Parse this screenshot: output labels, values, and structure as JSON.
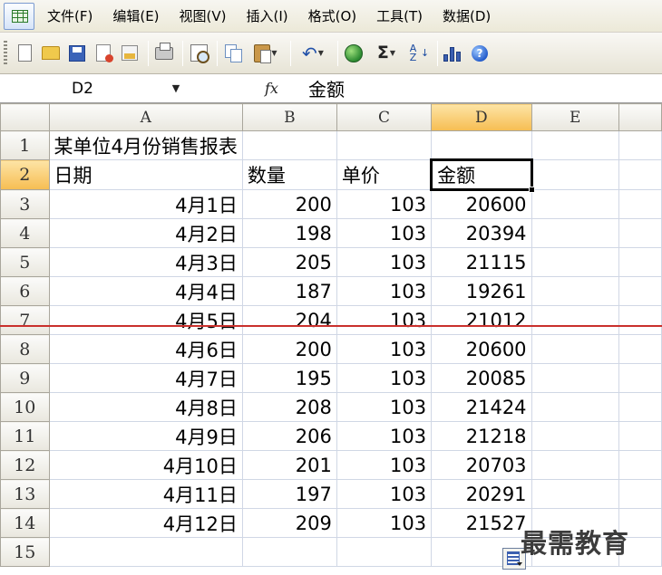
{
  "menu": {
    "items": [
      "文件(F)",
      "编辑(E)",
      "视图(V)",
      "插入(I)",
      "格式(O)",
      "工具(T)",
      "数据(D)"
    ]
  },
  "toolbar": {
    "icons": [
      "new-icon",
      "open-icon",
      "save-icon",
      "permission-icon",
      "email-icon",
      "print-icon",
      "print-preview-icon",
      "copy-icon",
      "paste-icon",
      "undo-icon",
      "hyperlink-icon",
      "autosum-icon",
      "sort-ascending-icon",
      "chart-wizard-icon",
      "help-icon"
    ],
    "sigma": "Σ",
    "sort_label": "A Z",
    "help_label": "?"
  },
  "formula_bar": {
    "name_box": "D2",
    "fx": "fx",
    "content": "金额"
  },
  "sheet": {
    "columns": [
      "A",
      "B",
      "C",
      "D",
      "E"
    ],
    "active_column": "D",
    "active_row": "2",
    "rows": [
      {
        "num": "1",
        "title": "某单位4月份销售报表"
      },
      {
        "num": "2",
        "a": "日期",
        "b": "数量",
        "c": "单价",
        "d": "金额"
      },
      {
        "num": "3",
        "a": "4月1日",
        "b": "200",
        "c": "103",
        "d": "20600"
      },
      {
        "num": "4",
        "a": "4月2日",
        "b": "198",
        "c": "103",
        "d": "20394"
      },
      {
        "num": "5",
        "a": "4月3日",
        "b": "205",
        "c": "103",
        "d": "21115"
      },
      {
        "num": "6",
        "a": "4月4日",
        "b": "187",
        "c": "103",
        "d": "19261"
      },
      {
        "num": "7",
        "a": "4月5日",
        "b": "204",
        "c": "103",
        "d": "21012"
      },
      {
        "num": "8",
        "a": "4月6日",
        "b": "200",
        "c": "103",
        "d": "20600"
      },
      {
        "num": "9",
        "a": "4月7日",
        "b": "195",
        "c": "103",
        "d": "20085"
      },
      {
        "num": "10",
        "a": "4月8日",
        "b": "208",
        "c": "103",
        "d": "21424"
      },
      {
        "num": "11",
        "a": "4月9日",
        "b": "206",
        "c": "103",
        "d": "21218"
      },
      {
        "num": "12",
        "a": "4月10日",
        "b": "201",
        "c": "103",
        "d": "20703"
      },
      {
        "num": "13",
        "a": "4月11日",
        "b": "197",
        "c": "103",
        "d": "20291"
      },
      {
        "num": "14",
        "a": "4月12日",
        "b": "209",
        "c": "103",
        "d": "21527"
      },
      {
        "num": "15"
      }
    ]
  },
  "colors": {
    "strike_line": "#c9302c",
    "active_header": "#f6bd52",
    "gridline": "#d0d7e5"
  },
  "watermark": "最需教育"
}
